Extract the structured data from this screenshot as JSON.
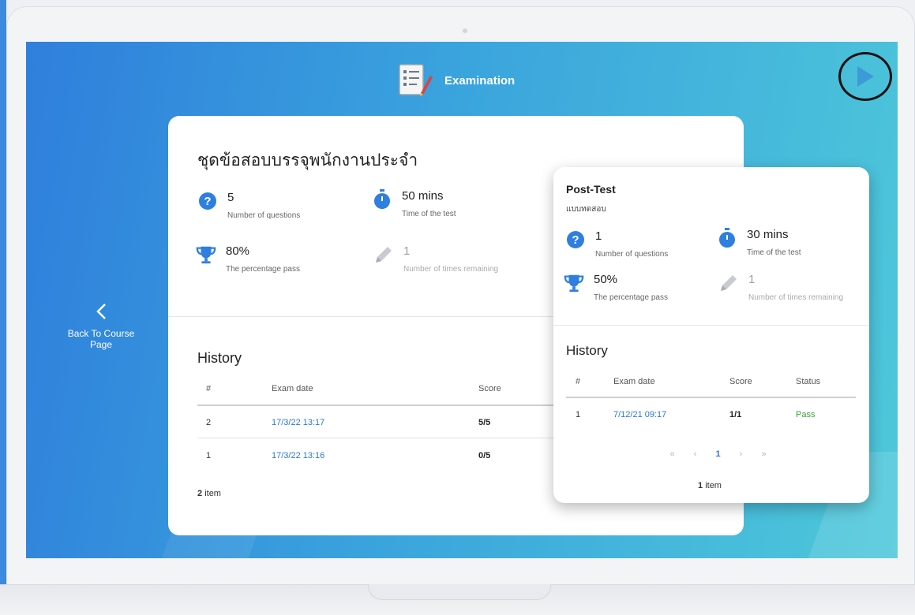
{
  "header": {
    "title": "Examination"
  },
  "nav": {
    "back_label": "Back To Course Page"
  },
  "exam": {
    "title": "ชุดข้อสอบบรรจุพนักงานประจำ",
    "stats": {
      "questions": {
        "value": "5",
        "label": "Number of questions"
      },
      "time": {
        "value": "50 mins",
        "label": "Time of the test"
      },
      "pass": {
        "value": "80%",
        "label": "The percentage pass"
      },
      "remaining": {
        "value": "1",
        "label": "Number of times remaining"
      }
    },
    "history": {
      "title": "History",
      "columns": {
        "num": "#",
        "date": "Exam date",
        "score": "Score"
      },
      "rows": [
        {
          "num": "2",
          "date": "17/3/22 13:17",
          "score": "5/5"
        },
        {
          "num": "1",
          "date": "17/3/22 13:16",
          "score": "0/5"
        }
      ],
      "count_number": "2",
      "count_label": "item"
    }
  },
  "post_test": {
    "title": "Post-Test",
    "subtitle": "แบบทดสอบ",
    "stats": {
      "questions": {
        "value": "1",
        "label": "Number of questions"
      },
      "time": {
        "value": "30 mins",
        "label": "Time of the test"
      },
      "pass": {
        "value": "50%",
        "label": "The percentage pass"
      },
      "remaining": {
        "value": "1",
        "label": "Number of times remaining"
      }
    },
    "history": {
      "title": "History",
      "columns": {
        "num": "#",
        "date": "Exam date",
        "score": "Score",
        "status": "Status"
      },
      "rows": [
        {
          "num": "1",
          "date": "7/12/21 09:17",
          "score": "1/1",
          "status": "Pass"
        }
      ],
      "pager": {
        "first": "«",
        "prev": "‹",
        "current": "1",
        "next": "›",
        "last": "»"
      },
      "count_number": "1",
      "count_label": "item"
    }
  },
  "colors": {
    "accent": "#2b78d6",
    "pass": "#3aa13a",
    "icon_blue": "#2f7fe0"
  },
  "icons": [
    "document-icon",
    "play-icon",
    "chevron-left-icon",
    "question-icon",
    "stopwatch-icon",
    "trophy-icon",
    "pencil-icon"
  ]
}
